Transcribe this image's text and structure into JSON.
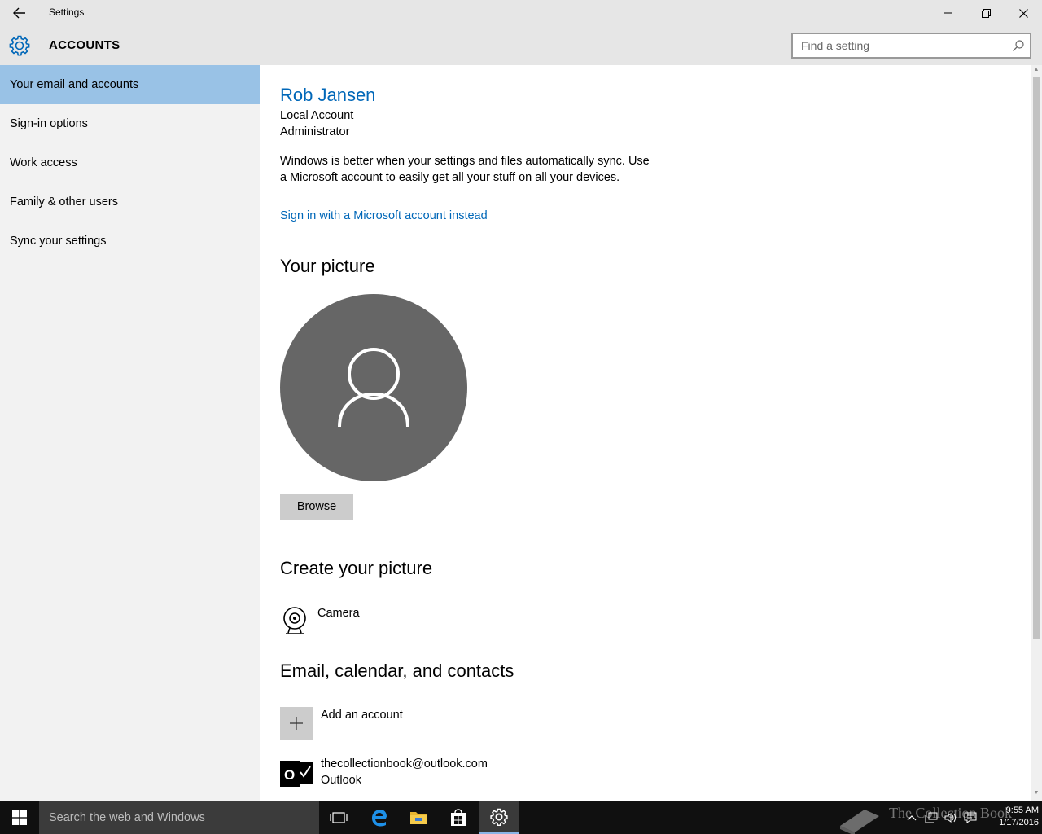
{
  "window": {
    "title": "Settings"
  },
  "header": {
    "section": "ACCOUNTS",
    "search_placeholder": "Find a setting"
  },
  "sidebar": {
    "items": [
      {
        "label": "Your email and accounts",
        "active": true
      },
      {
        "label": "Sign-in options",
        "active": false
      },
      {
        "label": "Work access",
        "active": false
      },
      {
        "label": "Family & other users",
        "active": false
      },
      {
        "label": "Sync your settings",
        "active": false
      }
    ]
  },
  "main": {
    "user_name": "Rob Jansen",
    "account_type": "Local Account",
    "account_role": "Administrator",
    "sync_message": "Windows is better when your settings and files automatically sync. Use a Microsoft account to easily get all your stuff on all your devices.",
    "ms_account_link": "Sign in with a Microsoft account instead",
    "your_picture_heading": "Your picture",
    "browse_label": "Browse",
    "create_picture_heading": "Create your picture",
    "camera_label": "Camera",
    "email_heading": "Email, calendar, and contacts",
    "add_account_label": "Add an account",
    "accounts": [
      {
        "email": "thecollectionbook@outlook.com",
        "provider": "Outlook"
      }
    ]
  },
  "taskbar": {
    "search_placeholder": "Search the web and Windows",
    "pinned": [
      "task-view-icon",
      "edge-icon",
      "file-explorer-icon",
      "store-icon",
      "settings-icon"
    ],
    "watermark": "The Collection Book",
    "time": "9:55 AM",
    "date": "1/17/2016"
  },
  "colors": {
    "accent": "#0067b8",
    "nav_active": "#99c2e6",
    "sidebar_bg": "#f2f2f2",
    "chrome_bg": "#e6e6e6",
    "taskbar_bg": "#101010",
    "avatar_bg": "#666666"
  }
}
